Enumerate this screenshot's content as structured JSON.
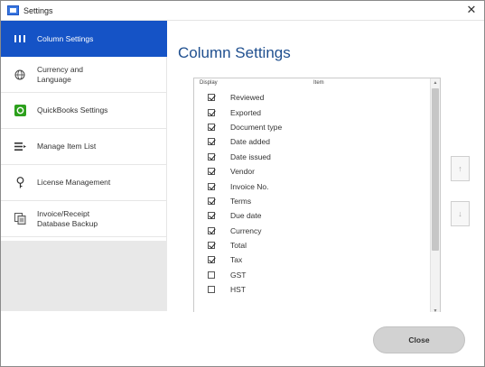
{
  "window": {
    "title": "Settings"
  },
  "sidebar": {
    "items": [
      {
        "label": "Column Settings",
        "icon": "column-bars-icon",
        "active": true
      },
      {
        "label": "Currency and\nLanguage",
        "icon": "globe-icon",
        "active": false
      },
      {
        "label": "QuickBooks Settings",
        "icon": "quickbooks-icon",
        "active": false
      },
      {
        "label": "Manage Item List",
        "icon": "list-icon",
        "active": false
      },
      {
        "label": "License Management",
        "icon": "key-icon",
        "active": false
      },
      {
        "label": "Invoice/Receipt\nDatabase Backup",
        "icon": "backup-icon",
        "active": false
      }
    ]
  },
  "main": {
    "title": "Column Settings",
    "list": {
      "header_display": "Display",
      "header_item": "Item",
      "rows": [
        {
          "label": "Reviewed",
          "checked": true
        },
        {
          "label": "Exported",
          "checked": true
        },
        {
          "label": "Document type",
          "checked": true
        },
        {
          "label": "Date added",
          "checked": true
        },
        {
          "label": "Date issued",
          "checked": true
        },
        {
          "label": "Vendor",
          "checked": true
        },
        {
          "label": "Invoice No.",
          "checked": true
        },
        {
          "label": "Terms",
          "checked": true
        },
        {
          "label": "Due date",
          "checked": true
        },
        {
          "label": "Currency",
          "checked": true
        },
        {
          "label": "Total",
          "checked": true
        },
        {
          "label": "Tax",
          "checked": true
        },
        {
          "label": "GST",
          "checked": false
        },
        {
          "label": "HST",
          "checked": false
        }
      ]
    },
    "move_up_label": "↑",
    "move_down_label": "↓"
  },
  "footer": {
    "close_label": "Close"
  },
  "colors": {
    "accent": "#1553c6",
    "title": "#1f4f8f"
  }
}
